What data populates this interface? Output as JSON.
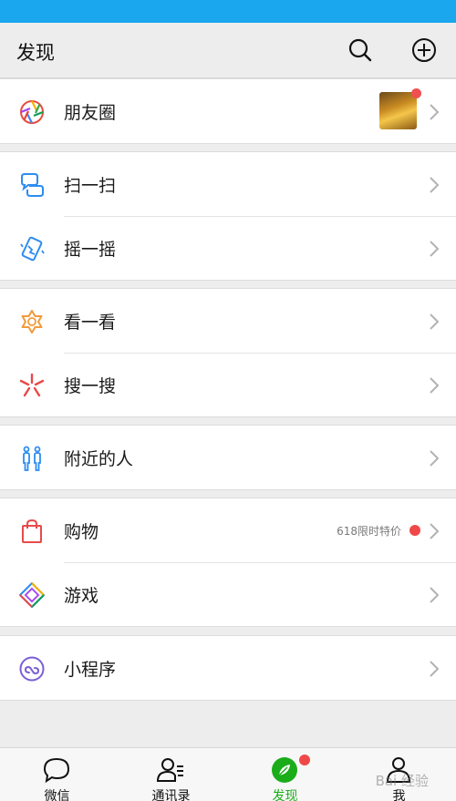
{
  "header": {
    "title": "发现",
    "search_icon": "search-icon",
    "add_icon": "plus-circle-icon"
  },
  "groups": [
    {
      "items": [
        {
          "label": "朋友圈",
          "icon": "moments-aperture-icon",
          "has_avatar": true,
          "has_dot": true
        }
      ]
    },
    {
      "items": [
        {
          "label": "扫一扫",
          "icon": "scan-icon"
        },
        {
          "label": "摇一摇",
          "icon": "shake-phone-icon"
        }
      ]
    },
    {
      "items": [
        {
          "label": "看一看",
          "icon": "top-stories-icon"
        },
        {
          "label": "搜一搜",
          "icon": "search-spark-icon"
        }
      ]
    },
    {
      "items": [
        {
          "label": "附近的人",
          "icon": "people-nearby-icon"
        }
      ]
    },
    {
      "items": [
        {
          "label": "购物",
          "icon": "shopping-bag-icon",
          "promo": "618限时特价",
          "has_dot": true
        },
        {
          "label": "游戏",
          "icon": "games-diamond-icon"
        }
      ]
    },
    {
      "items": [
        {
          "label": "小程序",
          "icon": "mini-program-icon"
        }
      ]
    }
  ],
  "tabs": [
    {
      "label": "微信",
      "icon": "chat-bubble-icon",
      "active": false
    },
    {
      "label": "通讯录",
      "icon": "contacts-icon",
      "active": false
    },
    {
      "label": "发现",
      "icon": "compass-icon",
      "active": true,
      "badge": true
    },
    {
      "label": "我",
      "icon": "person-icon",
      "active": false
    }
  ],
  "watermark": "Bai 经验",
  "colors": {
    "status_bar": "#1aa7ee",
    "active_tab": "#1aad19",
    "badge": "#f04848",
    "background": "#ededed"
  }
}
